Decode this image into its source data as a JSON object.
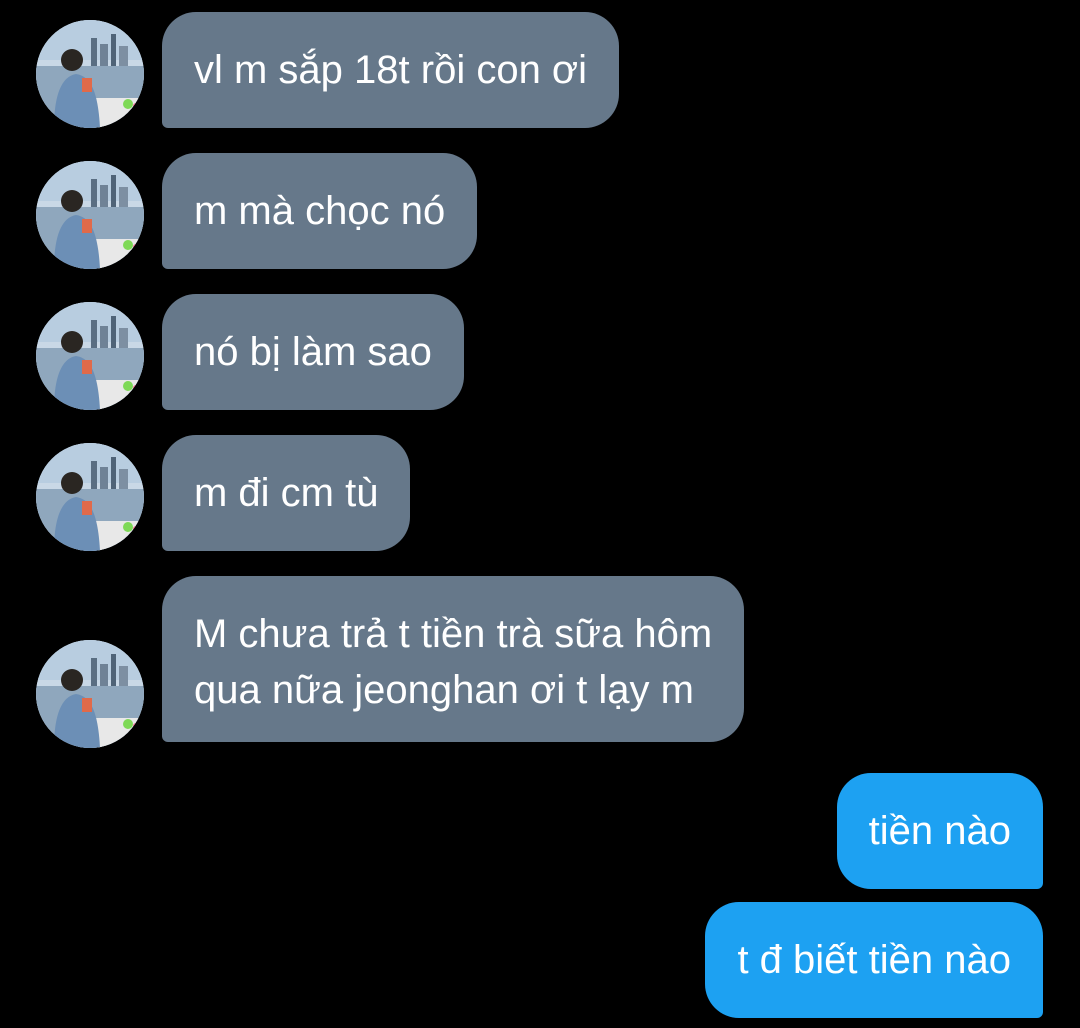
{
  "conversation": {
    "incoming": [
      {
        "text": "vl m sắp 18t rồi con ơi"
      },
      {
        "text": "m mà chọc nó"
      },
      {
        "text": "nó bị làm sao"
      },
      {
        "text": "m đi cm tù"
      },
      {
        "text": "M chưa trả t tiền trà sữa hôm qua nữa jeonghan ơi t lạy m",
        "line1": "M chưa trả t tiền trà sữa hôm",
        "line2": "qua nữa jeonghan ơi t lạy m"
      }
    ],
    "outgoing": [
      {
        "text": "tiền nào"
      },
      {
        "text": "t đ biết tiền nào"
      }
    ]
  },
  "colors": {
    "background": "#000000",
    "incoming_bubble": "#66788a",
    "outgoing_bubble": "#1da1f2",
    "text": "#ffffff"
  },
  "icons": {
    "avatar": "profile-photo-avatar"
  }
}
